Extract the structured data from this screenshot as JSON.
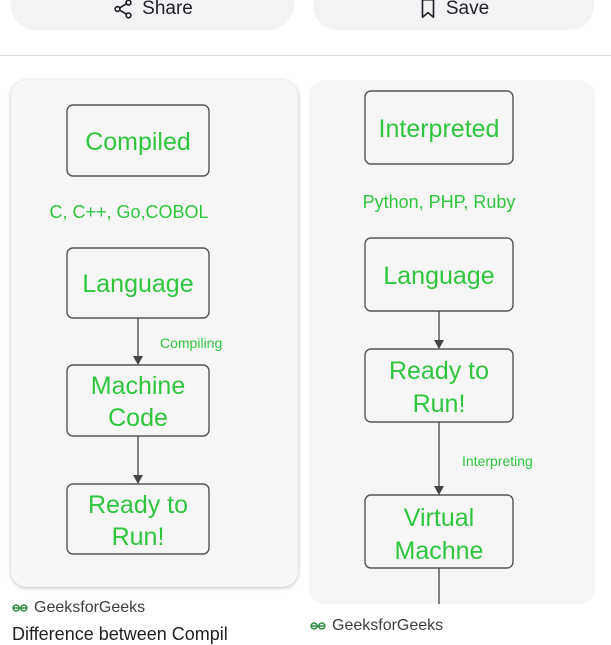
{
  "actions": {
    "share_label": "Share",
    "save_label": "Save"
  },
  "results": [
    {
      "diagram": {
        "box1": "Compiled",
        "examples": "C, C++, Go,COBOL",
        "box2": "Language",
        "step_label": "Compiling",
        "box3_line1": "Machine",
        "box3_line2": "Code",
        "box4_line1": "Ready to",
        "box4_line2": "Run!"
      },
      "source": "GeeksforGeeks",
      "title": "Difference between Compil"
    },
    {
      "diagram": {
        "box1": "Interpreted",
        "examples": "Python, PHP, Ruby",
        "box2": "Language",
        "box3_line1": "Ready to",
        "box3_line2": "Run!",
        "step_label": "Interpreting",
        "box4_line1": "Virtual",
        "box4_line2": "Machne"
      },
      "source": "GeeksforGeeks"
    }
  ],
  "colors": {
    "diagram_text": "#2fc53f",
    "source_logo": "#2f8d46"
  }
}
